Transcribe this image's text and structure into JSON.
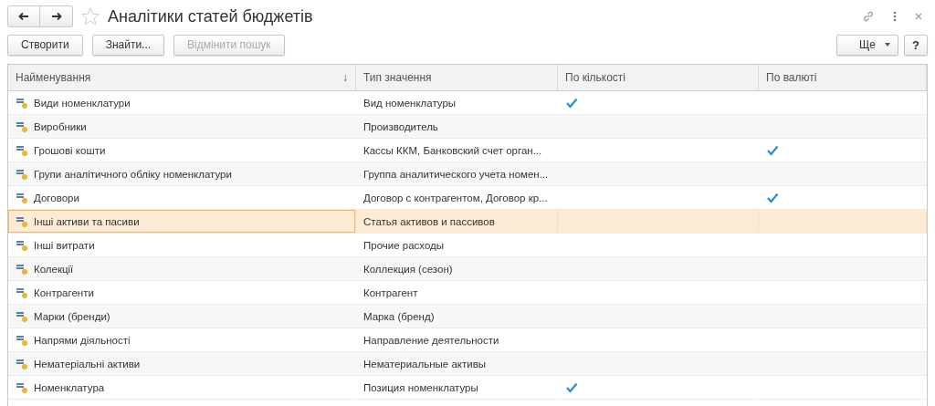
{
  "window": {
    "title": "Аналітики статей бюджетів",
    "favorite": false
  },
  "toolbar": {
    "buttons": [
      {
        "label": "Створити",
        "disabled": false
      },
      {
        "label": "Знайти...",
        "disabled": false
      },
      {
        "label": "Відмінити пошук",
        "disabled": true
      }
    ],
    "more": "Ще",
    "help": "?"
  },
  "table": {
    "columns": [
      {
        "label": "Найменування",
        "sort": "↓"
      },
      {
        "label": "Тип значення"
      },
      {
        "label": "По кількості"
      },
      {
        "label": "По валюті"
      }
    ],
    "rows": [
      {
        "name": "Види номенклатури",
        "type": "Вид номенклатуры",
        "by_quantity": true,
        "by_currency": false,
        "selected": false
      },
      {
        "name": "Виробники",
        "type": "Производитель",
        "by_quantity": false,
        "by_currency": false,
        "selected": false
      },
      {
        "name": "Грошові кошти",
        "type": "Кассы ККМ, Банковский счет орган...",
        "by_quantity": false,
        "by_currency": true,
        "selected": false
      },
      {
        "name": "Групи аналітичного обліку номенклатури",
        "type": "Группа аналитического учета номен...",
        "by_quantity": false,
        "by_currency": false,
        "selected": false
      },
      {
        "name": "Договори",
        "type": "Договор с контрагентом, Договор кр...",
        "by_quantity": false,
        "by_currency": true,
        "selected": false
      },
      {
        "name": "Інші активи та пасиви",
        "type": "Статья активов и пассивов",
        "by_quantity": false,
        "by_currency": false,
        "selected": true
      },
      {
        "name": "Інші витрати",
        "type": "Прочие расходы",
        "by_quantity": false,
        "by_currency": false,
        "selected": false
      },
      {
        "name": "Колекції",
        "type": "Коллекция (сезон)",
        "by_quantity": false,
        "by_currency": false,
        "selected": false
      },
      {
        "name": "Контрагенти",
        "type": "Контрагент",
        "by_quantity": false,
        "by_currency": false,
        "selected": false
      },
      {
        "name": "Марки (бренди)",
        "type": "Марка (бренд)",
        "by_quantity": false,
        "by_currency": false,
        "selected": false
      },
      {
        "name": "Напрями діяльності",
        "type": "Направление деятельности",
        "by_quantity": false,
        "by_currency": false,
        "selected": false
      },
      {
        "name": "Нематеріальні активи",
        "type": "Нематериальные активы",
        "by_quantity": false,
        "by_currency": false,
        "selected": false
      },
      {
        "name": "Номенклатура",
        "type": "Позиция номенклатуры",
        "by_quantity": true,
        "by_currency": false,
        "selected": false
      }
    ]
  }
}
